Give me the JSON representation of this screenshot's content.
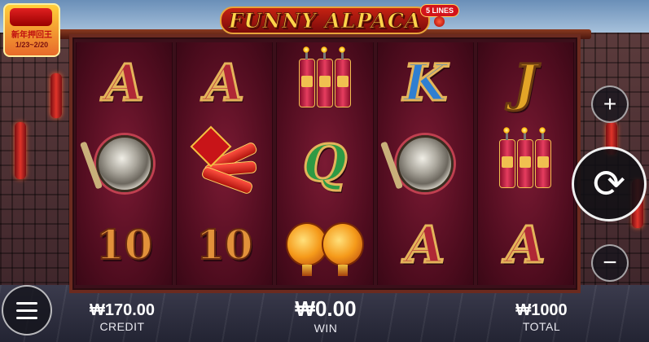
{
  "game": {
    "logo_text": "FUNNY ALPACA",
    "lines_badge": "5 LINES"
  },
  "promo": {
    "title": "新年押回王",
    "date": "1/23~2/20"
  },
  "reels": [
    [
      "A",
      "gong",
      "10"
    ],
    [
      "A",
      "bundle",
      "10"
    ],
    [
      "firecrackers",
      "Q",
      "lanterns"
    ],
    [
      "K",
      "gong",
      "A"
    ],
    [
      "J",
      "firecrackers",
      "A"
    ]
  ],
  "stats": {
    "credit_value": "₩170.00",
    "credit_label": "CREDIT",
    "win_value": "₩0.00",
    "win_label": "WIN",
    "total_value": "₩1000",
    "total_label": "TOTAL"
  },
  "buttons": {
    "plus": "+",
    "minus": "−",
    "spin": "⟳"
  },
  "colors": {
    "accent": "#ffd44a",
    "reel_bg": "#5a0d22"
  }
}
